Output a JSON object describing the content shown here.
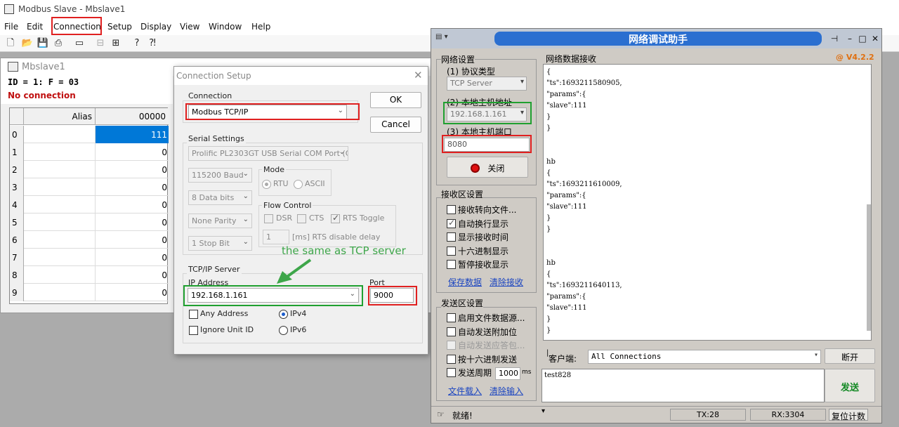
{
  "modbus": {
    "title": "Modbus Slave - Mbslave1",
    "menu": [
      "File",
      "Edit",
      "Connection",
      "Setup",
      "Display",
      "View",
      "Window",
      "Help"
    ],
    "doc_title": "Mbslave1",
    "id_line": "ID = 1: F = 03",
    "status": "No connection",
    "grid": {
      "headers": [
        "Alias",
        "00000"
      ],
      "rows": [
        {
          "index": "0",
          "value": "111"
        },
        {
          "index": "1",
          "value": "0"
        },
        {
          "index": "2",
          "value": "0"
        },
        {
          "index": "3",
          "value": "0"
        },
        {
          "index": "4",
          "value": "0"
        },
        {
          "index": "5",
          "value": "0"
        },
        {
          "index": "6",
          "value": "0"
        },
        {
          "index": "7",
          "value": "0"
        },
        {
          "index": "8",
          "value": "0"
        },
        {
          "index": "9",
          "value": "0"
        }
      ]
    }
  },
  "dialog": {
    "title": "Connection Setup",
    "connection_group": "Connection",
    "connection_value": "Modbus TCP/IP",
    "ok": "OK",
    "cancel": "Cancel",
    "serial_group": "Serial Settings",
    "serial_port": "Prolific PL2303GT USB Serial COM Port (CO",
    "baud": "115200 Baud",
    "data_bits": "8 Data bits",
    "parity": "None Parity",
    "stop_bit": "1 Stop Bit",
    "mode_group": "Mode",
    "mode_rtu": "RTU",
    "mode_ascii": "ASCII",
    "flow_group": "Flow Control",
    "dsr": "DSR",
    "cts": "CTS",
    "rts_toggle": "RTS Toggle",
    "rts_delay_value": "1",
    "rts_delay_label": "[ms] RTS disable delay",
    "tcp_group": "TCP/IP Server",
    "ip_label": "IP Address",
    "ip_value": "192.168.1.161",
    "port_label": "Port",
    "port_value": "9000",
    "any_address": "Any Address",
    "ignore_unit": "Ignore Unit ID",
    "ipv4": "IPv4",
    "ipv6": "IPv6"
  },
  "annotation": "the same as TCP server",
  "net": {
    "title": "网络调试助手",
    "version": "@ V4.2.2",
    "settings_group": "网络设置",
    "protocol_label": "(1) 协议类型",
    "protocol_value": "TCP Server",
    "host_label": "(2) 本地主机地址",
    "host_value": "192.168.1.161",
    "port_label": "(3) 本地主机端口",
    "port_value": "8080",
    "close_button": "关闭",
    "recv_settings_group": "接收区设置",
    "recv_options": [
      "接收转向文件...",
      "自动换行显示",
      "显示接收时间",
      "十六进制显示",
      "暂停接收显示"
    ],
    "save_data": "保存数据",
    "clear_recv": "清除接收",
    "send_settings_group": "发送区设置",
    "send_options": [
      "启用文件数据源...",
      "自动发送附加位",
      "自动发送应答包...",
      "按十六进制发送",
      "发送周期"
    ],
    "period_value": "1000",
    "period_unit": "ms",
    "load_file": "文件载入",
    "clear_input": "清除输入",
    "recv_area_label": "网络数据接收",
    "recv_text": "{\n\"ts\":1693211580905,\n\"params\":{\n\"slave\":111\n}\n}\n\n\nhb\n{\n\"ts\":1693211610009,\n\"params\":{\n\"slave\":111\n}\n}\n\n\nhb\n{\n\"ts\":1693211640113,\n\"params\":{\n\"slave\":111\n}\n}\n\n|",
    "client_label": "客户端:",
    "client_value": "All Connections",
    "disconnect": "断开",
    "send_text": "test828",
    "send_button": "发送",
    "status_ready": "就绪!",
    "tx": "TX:28",
    "rx": "RX:3304",
    "reset_count": "复位计数"
  }
}
